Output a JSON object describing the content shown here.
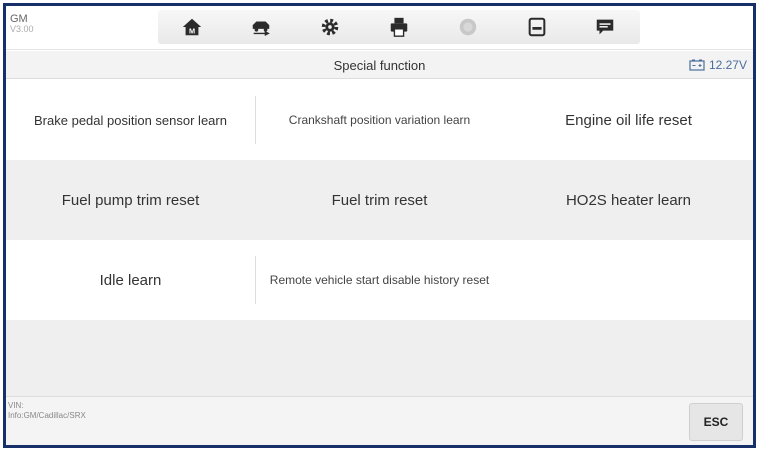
{
  "header": {
    "brand": "GM",
    "version": "V3.00"
  },
  "toolbar": {
    "icons": [
      "home-icon",
      "vehicle-swap-icon",
      "gear-icon",
      "printer-icon",
      "help-icon",
      "save-icon",
      "message-icon"
    ]
  },
  "titlebar": {
    "title": "Special function",
    "voltage": "12.27V"
  },
  "functions": [
    "Brake pedal position sensor learn",
    "Crankshaft position variation learn",
    "Engine oil life reset",
    "Fuel pump trim reset",
    "Fuel trim reset",
    "HO2S heater learn",
    "Idle learn",
    "Remote vehicle start disable history reset"
  ],
  "footer": {
    "vin_label": "VIN:",
    "vehicle_info": "Info:GM/Cadillac/SRX",
    "esc_label": "ESC"
  },
  "colors": {
    "frame_border": "#17306a",
    "row_shade": "#efefef",
    "voltage_text": "#4a6e9c"
  }
}
